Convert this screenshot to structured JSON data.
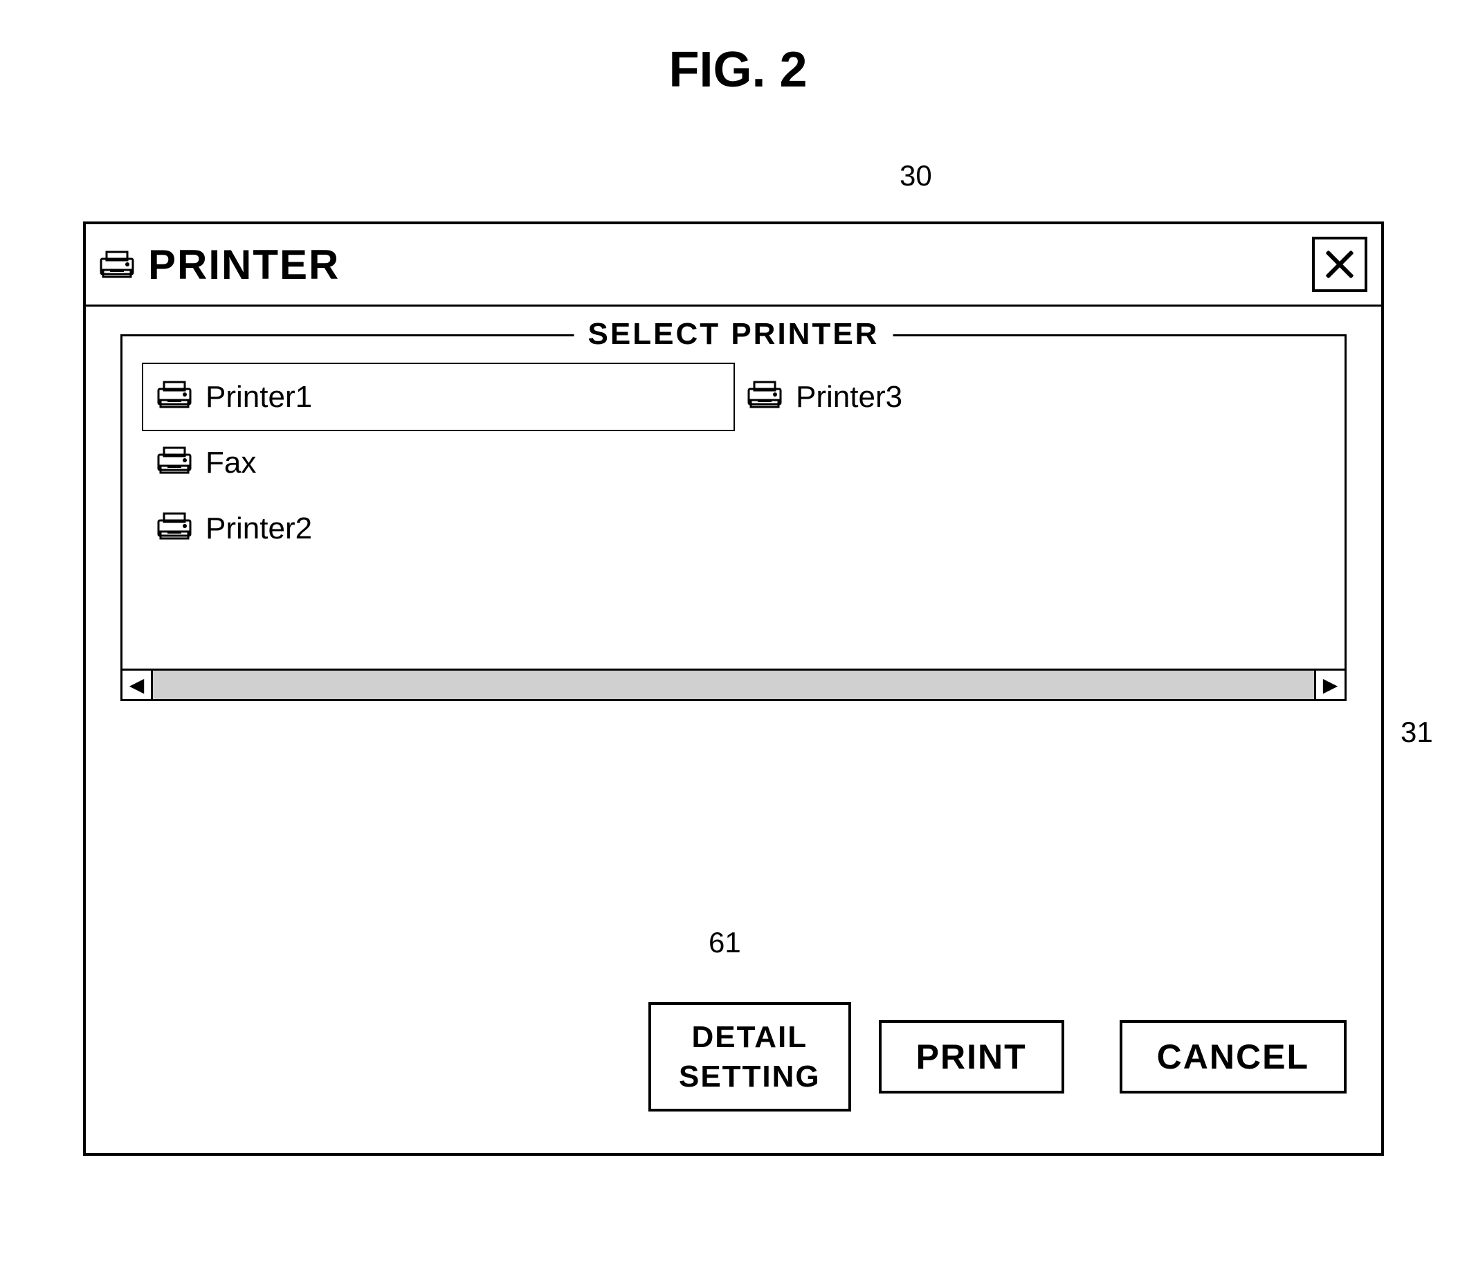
{
  "page": {
    "title": "FIG. 2"
  },
  "annotations": {
    "dialog_number": "30",
    "detail_setting_number": "31",
    "print_number": "61"
  },
  "dialog": {
    "title": "PRINTER",
    "close_button_label": "✕",
    "select_printer_legend": "SELECT PRINTER",
    "printers": [
      {
        "id": "printer1",
        "name": "Printer1",
        "selected": true
      },
      {
        "id": "printer3",
        "name": "Printer3",
        "selected": false
      },
      {
        "id": "fax",
        "name": "Fax",
        "selected": false
      },
      {
        "id": "printer2",
        "name": "Printer2",
        "selected": false
      }
    ],
    "buttons": {
      "detail_setting": "DETAIL\nSETTING",
      "detail_setting_line1": "DETAIL",
      "detail_setting_line2": "SETTING",
      "print": "PRINT",
      "cancel": "CANCEL"
    }
  }
}
